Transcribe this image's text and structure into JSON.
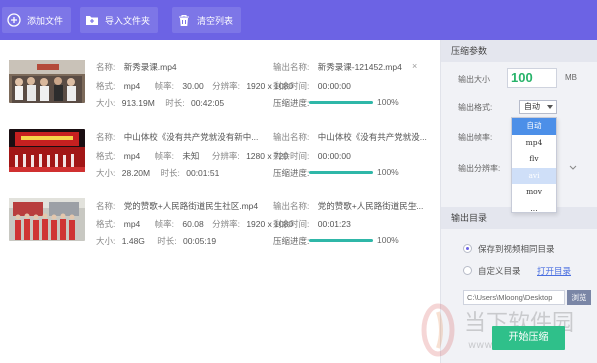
{
  "toolbar": {
    "add_label": "添加文件",
    "import_label": "导入文件夹",
    "clear_label": "清空列表",
    "bg_color": "#6c63e4"
  },
  "labels": {
    "name": "名称:",
    "out_name": "输出名称:",
    "format": "格式:",
    "fps": "帧率:",
    "resolution": "分辨率:",
    "remaining": "剩余时间:",
    "size": "大小:",
    "duration": "时长:",
    "progress": "压缩进度:",
    "close": "×"
  },
  "files": [
    {
      "name": "新秀录课.mp4",
      "out_name": "新秀录课-121452.mp4",
      "format": "mp4",
      "fps": "30.00",
      "resolution": "1920 x 1080",
      "remaining": "00:00:00",
      "size": "913.19M",
      "duration": "00:42:05",
      "progress": 1.0,
      "progress_text": "100%"
    },
    {
      "name": "中山体校《没有共产党就没有新中...",
      "out_name": "中山体校《没有共产党就没...",
      "format": "mp4",
      "fps": "未知",
      "resolution": "1280 x 720",
      "remaining": "00:00:00",
      "size": "28.20M",
      "duration": "00:01:51",
      "progress": 1.0,
      "progress_text": "100%"
    },
    {
      "name": "党的赞歌+人民路街道民生社区.mp4",
      "out_name": "党的赞歌+人民路街道民生...",
      "format": "mp4",
      "fps": "60.08",
      "resolution": "1920 x 1080",
      "remaining": "00:01:23",
      "size": "1.48G",
      "duration": "00:05:19",
      "progress": 1.0,
      "progress_text": "100%"
    }
  ],
  "panel": {
    "params_title": "压缩参数",
    "size_label": "输出大小",
    "size_value": "100",
    "size_unit": "MB",
    "format_label": "输出格式:",
    "format_selected": "自动",
    "fps_label": "输出帧率:",
    "resolution_label": "输出分辨率:",
    "format_options": [
      "自动",
      "mp4",
      "flv",
      "avi",
      "mov",
      "..."
    ],
    "output_title": "输出目录",
    "radio_same": "保存到视频相同目录",
    "radio_custom": "自定义目录",
    "open_dir": "打开目录",
    "path": "C:\\Users\\Mloong\\Desktop",
    "browse": "浏览",
    "start": "开始压缩"
  },
  "watermark": {
    "cn": "当下软件园",
    "en": "www.downxia.com"
  },
  "colors": {
    "accent": "#6c63e4",
    "progress": "#2fb7a8",
    "start": "#2fc08a",
    "size_value": "#27b36a"
  },
  "icons": [
    "plus-circle-icon",
    "folder-icon",
    "trash-icon",
    "close-icon",
    "chevron-down-icon"
  ]
}
